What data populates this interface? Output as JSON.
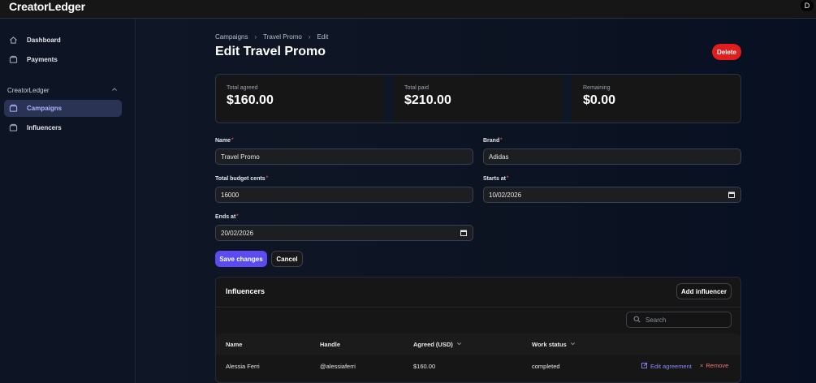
{
  "app": {
    "name": "CreatorLedger",
    "user_initial": "D"
  },
  "sidebar": {
    "items": [
      {
        "label": "Dashboard",
        "icon": "home-icon"
      },
      {
        "label": "Payments",
        "icon": "wallet-icon"
      }
    ],
    "section": {
      "label": "CreatorLedger",
      "items": [
        {
          "label": "Campaigns",
          "icon": "box-icon",
          "active": true
        },
        {
          "label": "Influencers",
          "icon": "box-icon",
          "active": false
        }
      ]
    }
  },
  "breadcrumb": [
    "Campaigns",
    "Travel Promo",
    "Edit"
  ],
  "page": {
    "title": "Edit Travel Promo",
    "delete_label": "Delete"
  },
  "stats": [
    {
      "label": "Total agreed",
      "value": "$160.00"
    },
    {
      "label": "Total paid",
      "value": "$210.00"
    },
    {
      "label": "Remaining",
      "value": "$0.00"
    }
  ],
  "form": {
    "name": {
      "label": "Name",
      "value": "Travel Promo"
    },
    "brand": {
      "label": "Brand",
      "value": "Adidas"
    },
    "budget": {
      "label": "Total budget cents",
      "value": "16000"
    },
    "starts": {
      "label": "Starts at",
      "value": "10/02/2026"
    },
    "ends": {
      "label": "Ends at",
      "value": "20/02/2026"
    },
    "save_label": "Save changes",
    "cancel_label": "Cancel"
  },
  "influencers": {
    "title": "Influencers",
    "add_label": "Add influencer",
    "search_placeholder": "Search",
    "columns": [
      "Name",
      "Handle",
      "Agreed (USD)",
      "Work status"
    ],
    "rows": [
      {
        "name": "Alessia Ferri",
        "handle": "@alessiaferri",
        "agreed": "$160.00",
        "status": "completed",
        "edit_label": "Edit agreement",
        "remove_label": "Remove"
      }
    ]
  },
  "colors": {
    "accent": "#5b4bf0",
    "danger": "#e11d1d",
    "link": "#818cf8",
    "remove": "#f87171"
  }
}
